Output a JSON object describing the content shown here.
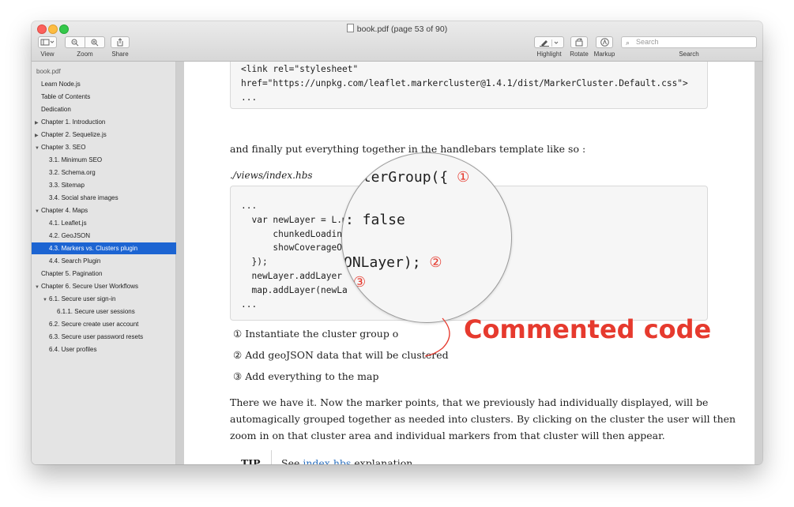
{
  "window": {
    "title": "book.pdf (page 53 of 90)"
  },
  "toolbar": {
    "view_label": "View",
    "zoom_label": "Zoom",
    "share_label": "Share",
    "highlight_label": "Highlight",
    "rotate_label": "Rotate",
    "markup_label": "Markup",
    "search_label": "Search",
    "search_placeholder": "Search"
  },
  "sidebar": {
    "items": [
      {
        "label": "book.pdf"
      },
      {
        "label": "Learn Node.js"
      },
      {
        "label": "Table of Contents"
      },
      {
        "label": "Dedication"
      },
      {
        "label": "Chapter 1. Introduction"
      },
      {
        "label": "Chapter 2. Sequelize.js"
      },
      {
        "label": "Chapter 3. SEO"
      },
      {
        "label": "3.1. Minimum SEO"
      },
      {
        "label": "3.2. Schema.org"
      },
      {
        "label": "3.3. Sitemap"
      },
      {
        "label": "3.4. Social share images"
      },
      {
        "label": "Chapter 4. Maps"
      },
      {
        "label": "4.1. Leaflet.js"
      },
      {
        "label": "4.2. GeoJSON"
      },
      {
        "label": "4.3. Markers vs. Clusters plugin"
      },
      {
        "label": "4.4. Search Plugin"
      },
      {
        "label": "Chapter 5. Pagination"
      },
      {
        "label": "Chapter 6. Secure User Workflows"
      },
      {
        "label": "6.1. Secure user sign-in"
      },
      {
        "label": "6.1.1. Secure user sessions"
      },
      {
        "label": "6.2. Secure create user account"
      },
      {
        "label": "6.3. Secure user password resets"
      },
      {
        "label": "6.4. User profiles"
      }
    ]
  },
  "page": {
    "code1": {
      "line1": "<link rel=\"stylesheet\"",
      "line2": "href=\"https://unpkg.com/leaflet.markercluster@1.4.1/dist/MarkerCluster.Default.css\">",
      "line3": "..."
    },
    "paragraph1": "and finally put everything together in the handlebars template like so :",
    "file_caption": "./views/index.hbs",
    "code2": {
      "line1": "...",
      "line2": "  var newLayer = L.ma",
      "line3": "      chunkedLoading",
      "line4": "      showCoverageOr",
      "line5": "  });",
      "line6": "  newLayer.addLayer",
      "line7": "  map.addLayer(newLa",
      "line8": "..."
    },
    "magnifier": {
      "line1": "sterGroup({",
      "line1_callout": "①",
      "line2": ",",
      "line3": ": false",
      "line4": "ONLayer);",
      "line4_callout": "②",
      "line5_callout": "③"
    },
    "callouts": [
      {
        "num": "①",
        "text": "Instantiate the cluster group o"
      },
      {
        "num": "②",
        "text": "Add geoJSON data that will be clustered"
      },
      {
        "num": "③",
        "text": "Add everything to the map"
      }
    ],
    "paragraph2": {
      "line1": "There we have it. Now the marker points, that we previously had individually displayed, will be",
      "line2": "automagically grouped together as needed into clusters. By clicking on the cluster the user will then",
      "line3": "zoom in on that cluster area and individual markers from that cluster will then appear."
    },
    "tip": {
      "label": "TIP",
      "prefix": "See",
      "link": "index.hbs",
      "suffix": "explanation"
    }
  },
  "annotation": {
    "text": "Commented code",
    "color": "#e63a2e"
  },
  "colors": {
    "selection": "#1c64d2",
    "link": "#2a6fbf"
  }
}
